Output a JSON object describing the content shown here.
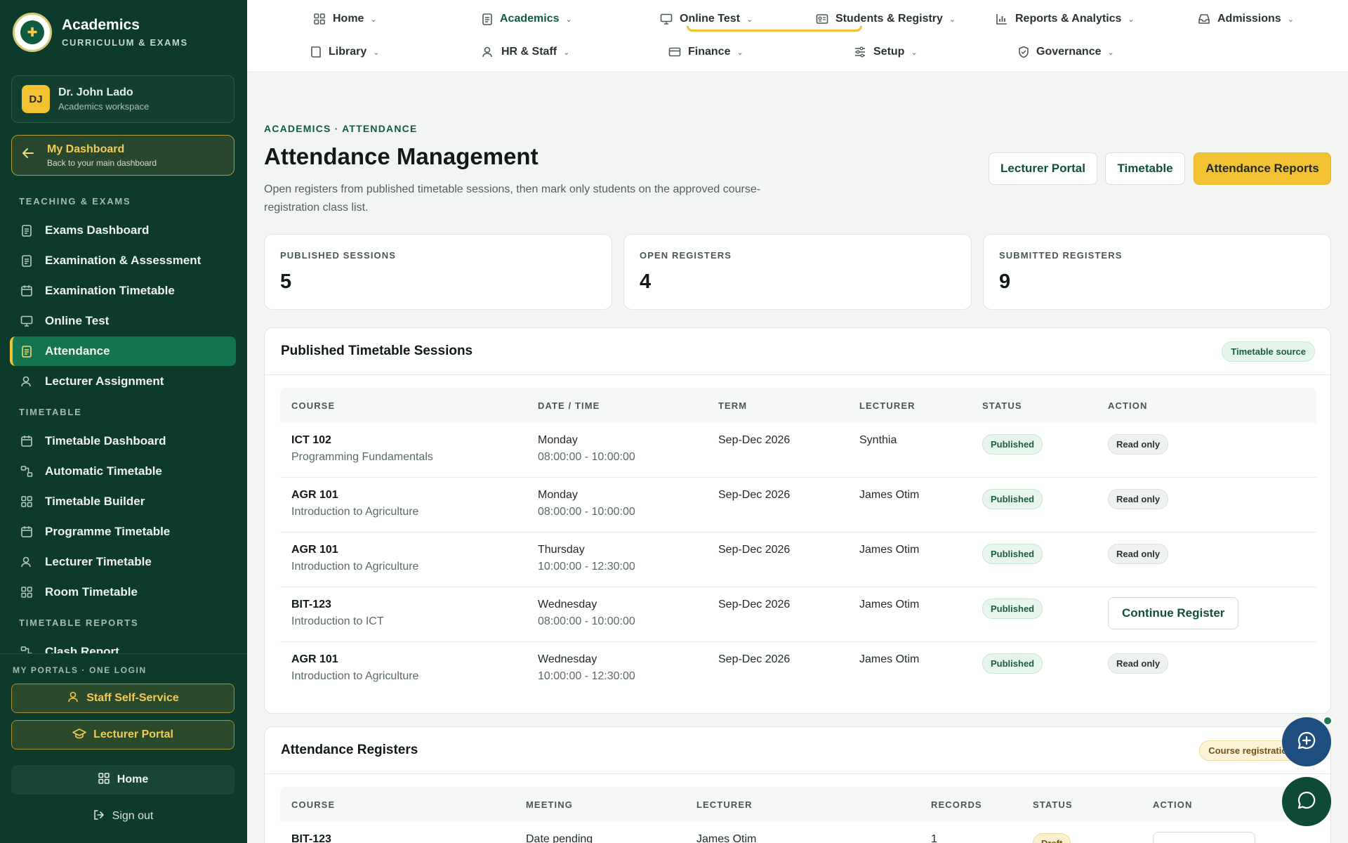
{
  "brand": {
    "title": "Academics",
    "subtitle": "CURRICULUM & EXAMS"
  },
  "user": {
    "initials": "DJ",
    "name": "Dr. John Lado",
    "role": "Academics workspace"
  },
  "dashboard_link": {
    "title": "My Dashboard",
    "subtitle": "Back to your main dashboard"
  },
  "sidebar": {
    "sections": [
      {
        "label": "TEACHING & EXAMS"
      },
      {
        "label": "TIMETABLE"
      },
      {
        "label": "TIMETABLE REPORTS"
      }
    ],
    "items": [
      {
        "label": "Exams Dashboard",
        "icon": "clipboard-icon"
      },
      {
        "label": "Examination & Assessment",
        "icon": "clipboard-icon"
      },
      {
        "label": "Examination Timetable",
        "icon": "calendar-icon"
      },
      {
        "label": "Online Test",
        "icon": "monitor-icon"
      },
      {
        "label": "Attendance",
        "icon": "clipboard-icon",
        "active": true
      },
      {
        "label": "Lecturer Assignment",
        "icon": "user-icon"
      },
      {
        "label": "Timetable Dashboard",
        "icon": "calendar-icon"
      },
      {
        "label": "Automatic Timetable",
        "icon": "flow-icon"
      },
      {
        "label": "Timetable Builder",
        "icon": "grid-icon"
      },
      {
        "label": "Programme Timetable",
        "icon": "calendar-icon"
      },
      {
        "label": "Lecturer Timetable",
        "icon": "user-icon"
      },
      {
        "label": "Room Timetable",
        "icon": "grid-icon"
      },
      {
        "label": "Clash Report",
        "icon": "flow-icon"
      }
    ],
    "portals_label": "MY PORTALS · ONE LOGIN",
    "portals": [
      {
        "label": "Staff Self-Service",
        "icon": "user-icon"
      },
      {
        "label": "Lecturer Portal",
        "icon": "graduation-cap-icon"
      }
    ],
    "home_label": "Home",
    "signout_label": "Sign out"
  },
  "topnav": {
    "items": [
      {
        "label": "Home",
        "icon": "grid-icon"
      },
      {
        "label": "Academics",
        "icon": "clipboard-icon",
        "active": true
      },
      {
        "label": "Online Test",
        "icon": "monitor-icon"
      },
      {
        "label": "Students & Registry",
        "icon": "id-card-icon"
      },
      {
        "label": "Reports & Analytics",
        "icon": "bar-chart-icon"
      },
      {
        "label": "Admissions",
        "icon": "inbox-icon"
      },
      {
        "label": "Library",
        "icon": "book-icon"
      },
      {
        "label": "HR & Staff",
        "icon": "user-icon"
      },
      {
        "label": "Finance",
        "icon": "card-icon"
      },
      {
        "label": "Setup",
        "icon": "sliders-icon"
      },
      {
        "label": "Governance",
        "icon": "shield-icon"
      }
    ]
  },
  "page": {
    "eyebrow": "ACADEMICS · ATTENDANCE",
    "title": "Attendance Management",
    "description": "Open registers from published timetable sessions, then mark only students on the approved course-registration class list.",
    "buttons": {
      "lecturer_portal": "Lecturer Portal",
      "timetable": "Timetable",
      "reports": "Attendance Reports"
    }
  },
  "stats": [
    {
      "label": "PUBLISHED SESSIONS",
      "value": "5"
    },
    {
      "label": "OPEN REGISTERS",
      "value": "4"
    },
    {
      "label": "SUBMITTED REGISTERS",
      "value": "9"
    }
  ],
  "sessions": {
    "title": "Published Timetable Sessions",
    "badge": "Timetable source",
    "columns": [
      "COURSE",
      "DATE / TIME",
      "TERM",
      "LECTURER",
      "STATUS",
      "ACTION"
    ],
    "rows": [
      {
        "code": "ICT 102",
        "name": "Programming Fundamentals",
        "day": "Monday",
        "time": "08:00:00 - 10:00:00",
        "term": "Sep-Dec 2026",
        "lecturer": "Synthia",
        "status": "Published",
        "action": "Read only",
        "action_type": "badge"
      },
      {
        "code": "AGR 101",
        "name": "Introduction to Agriculture",
        "day": "Monday",
        "time": "08:00:00 - 10:00:00",
        "term": "Sep-Dec 2026",
        "lecturer": "James Otim",
        "status": "Published",
        "action": "Read only",
        "action_type": "badge"
      },
      {
        "code": "AGR 101",
        "name": "Introduction to Agriculture",
        "day": "Thursday",
        "time": "10:00:00 - 12:30:00",
        "term": "Sep-Dec 2026",
        "lecturer": "James Otim",
        "status": "Published",
        "action": "Read only",
        "action_type": "badge"
      },
      {
        "code": "BIT-123",
        "name": "Introduction to ICT",
        "day": "Wednesday",
        "time": "08:00:00 - 10:00:00",
        "term": "Sep-Dec 2026",
        "lecturer": "James Otim",
        "status": "Published",
        "action": "Continue Register",
        "action_type": "button"
      },
      {
        "code": "AGR 101",
        "name": "Introduction to Agriculture",
        "day": "Wednesday",
        "time": "10:00:00 - 12:30:00",
        "term": "Sep-Dec 2026",
        "lecturer": "James Otim",
        "status": "Published",
        "action": "Read only",
        "action_type": "badge"
      }
    ]
  },
  "registers": {
    "title": "Attendance Registers",
    "badge": "Course registration so",
    "columns": [
      "COURSE",
      "MEETING",
      "LECTURER",
      "RECORDS",
      "STATUS",
      "ACTION"
    ],
    "rows": [
      {
        "code": "BIT-123",
        "meeting": "Date pending",
        "lecturer": "James Otim",
        "records": "1",
        "status": "Draft"
      }
    ]
  },
  "colors": {
    "sidebar_bg": "#0c3a2b",
    "accent_yellow": "#f2c232",
    "brand_green": "#0f5c40",
    "active_green": "#13744f"
  }
}
